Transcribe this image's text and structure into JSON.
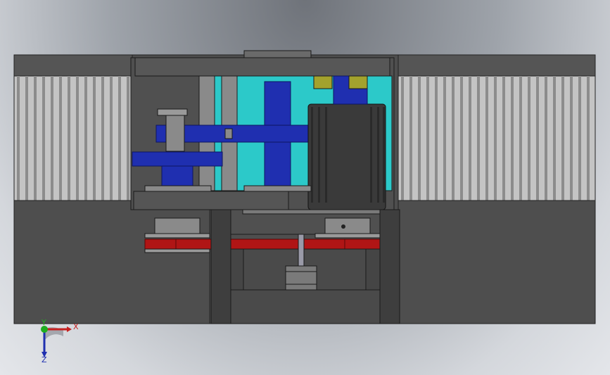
{
  "viewport": {
    "background": "#9ea3aa",
    "model": {
      "colors": {
        "housing": "#4f4f4f",
        "housing_dark": "#3a3a3a",
        "fin": "#bdbdbd",
        "cyan": "#2cc9c9",
        "blue": "#1f2fb0",
        "gray_metal": "#8a8a8a",
        "red_belt": "#b01515",
        "olive": "#a3a22d",
        "motor": "#3a3a3a"
      }
    },
    "triad": {
      "x_label": "X",
      "y_label": "Y",
      "z_label": "Z",
      "x_color": "#c62020",
      "y_color": "#1fae1f",
      "z_color": "#1f2fb0"
    }
  }
}
